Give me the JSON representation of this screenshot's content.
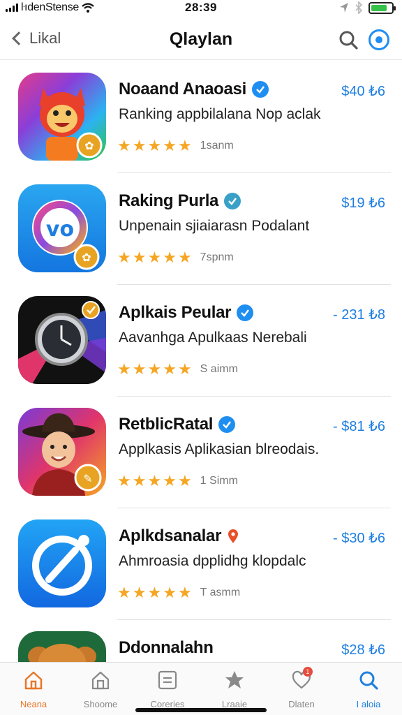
{
  "status_bar": {
    "carrier": "ŀıdenStense",
    "time": "28:39",
    "battery_level": 0.8,
    "battery_color": "#36c24a"
  },
  "nav": {
    "back_label": "Likal",
    "title": "Qlaylan",
    "search_icon": "search-icon",
    "account_icon": "account-icon"
  },
  "apps": [
    {
      "name": "Noaand Anaoasi",
      "badge": "verified",
      "price": "$40 ₺6",
      "description": "Ranking appbilalana Nop aclak",
      "stars": 5,
      "meta": "1sanm"
    },
    {
      "name": "Raking Purla",
      "badge": "verified",
      "price": "$19 ₺6",
      "description": "Unpenain sjiaiarasn Podalant",
      "stars": 5,
      "meta": "7spnm"
    },
    {
      "name": "Aplkais Peular",
      "badge": "verified",
      "price": "- 231 ₺8",
      "description": "Aavanhga Apulkaas Nerebali",
      "stars": 5,
      "meta": "S aimm"
    },
    {
      "name": "RetblicRatal",
      "badge": "verified",
      "price": "- $81 ₺6",
      "description": "Applkasis Aplikasian blreodais.",
      "stars": 5,
      "meta": "1 Simm"
    },
    {
      "name": "Aplkdsanalar",
      "badge": "pin",
      "price": "- $30 ₺6",
      "description": "Ahmroasia dpplidhg klopdalc",
      "stars": 5,
      "meta": "T asmm"
    },
    {
      "name": "Ddonnalahn",
      "badge": "none",
      "price": "$28 ₺6",
      "description": "",
      "stars": 0,
      "meta": ""
    }
  ],
  "tabs": [
    {
      "label": "Neana",
      "icon": "home-icon"
    },
    {
      "label": "Shoome",
      "icon": "store-icon"
    },
    {
      "label": "Coreries",
      "icon": "categories-icon"
    },
    {
      "label": "Lraaie",
      "icon": "star-icon"
    },
    {
      "label": "Dlaten",
      "icon": "heart-icon",
      "badge": "1"
    },
    {
      "label": "I aloia",
      "icon": "search-icon"
    }
  ],
  "colors": {
    "accent": "#1f8ef1",
    "price": "#1f7fe0",
    "star": "#f5a623",
    "active_home": "#e8762a"
  }
}
